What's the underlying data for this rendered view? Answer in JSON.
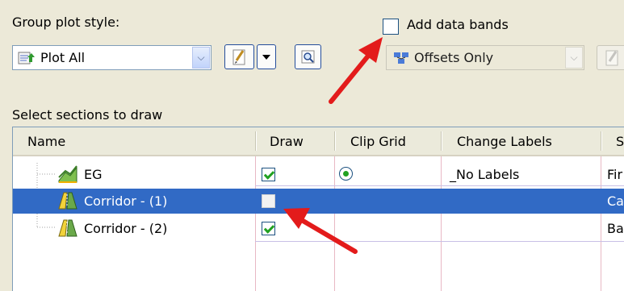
{
  "group_plot_style": {
    "label": "Group plot style:",
    "selected": "Plot All"
  },
  "data_bands": {
    "checkbox_label": "Add data bands",
    "checked": false,
    "style_selected": "Offsets Only"
  },
  "sections": {
    "label": "Select sections to draw",
    "columns": [
      "Name",
      "Draw",
      "Clip Grid",
      "Change Labels",
      "S"
    ],
    "rows": [
      {
        "name": "EG",
        "draw": true,
        "clip_grid": true,
        "change_labels": "_No Labels",
        "style": "Fir",
        "icon": "surface-icon",
        "selected": false
      },
      {
        "name": "Corridor - (1)",
        "draw": false,
        "clip_grid": false,
        "change_labels": "",
        "style": "Ca",
        "icon": "corridor-icon",
        "selected": true
      },
      {
        "name": "Corridor - (2)",
        "draw": true,
        "clip_grid": false,
        "change_labels": "",
        "style": "Ba",
        "icon": "corridor-icon",
        "selected": false
      }
    ]
  },
  "colors": {
    "selection": "#316ac5",
    "arrow": "#e31b1b",
    "check": "#21a121"
  }
}
